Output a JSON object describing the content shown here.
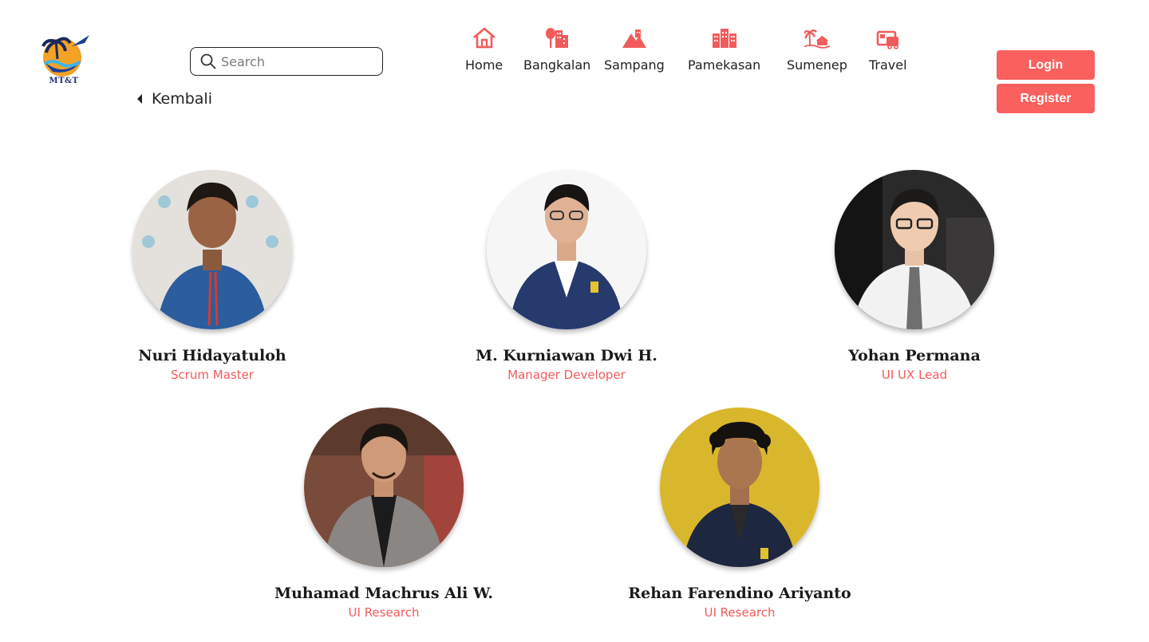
{
  "brand": {
    "logo_text": "MT&T"
  },
  "search": {
    "placeholder": "Search"
  },
  "back": {
    "label": "Kembali"
  },
  "nav": {
    "items": [
      {
        "label": "Home",
        "icon": "home-icon"
      },
      {
        "label": "Bangkalan",
        "icon": "city-tree-icon"
      },
      {
        "label": "Sampang",
        "icon": "mountain-icon"
      },
      {
        "label": "Pamekasan",
        "icon": "buildings-icon"
      },
      {
        "label": "Sumenep",
        "icon": "beach-house-icon"
      },
      {
        "label": "Travel",
        "icon": "bus-icon"
      }
    ]
  },
  "auth": {
    "login_label": "Login",
    "register_label": "Register"
  },
  "team": [
    {
      "name": "Nuri Hidayatuloh",
      "role": "Scrum Master"
    },
    {
      "name": "M. Kurniawan Dwi H.",
      "role": "Manager Developer"
    },
    {
      "name": "Yohan Permana",
      "role": "UI UX Lead"
    },
    {
      "name": "Muhamad Machrus Ali W.",
      "role": "UI Research"
    },
    {
      "name": "Rehan Farendino Ariyanto",
      "role": "UI Research"
    }
  ],
  "colors": {
    "accent": "#f9605e",
    "role_text": "#f25b5b",
    "brand_navy": "#1d2f7a"
  }
}
